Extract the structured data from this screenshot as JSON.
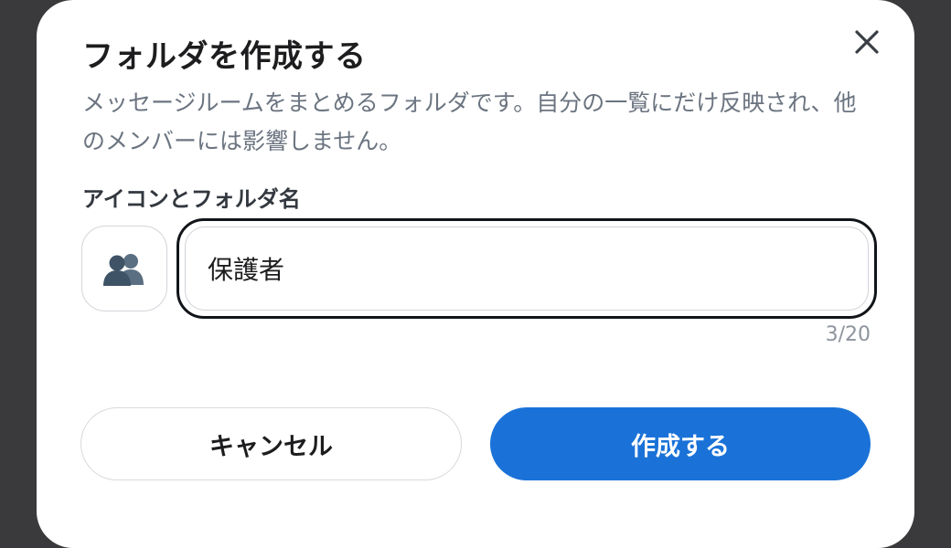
{
  "dialog": {
    "title": "フォルダを作成する",
    "description": "メッセージルームをまとめるフォルダです。自分の一覧にだけ反映され、他のメンバーには影響しません。",
    "close_icon": "close-icon"
  },
  "folder_form": {
    "label": "アイコンとフォルダ名",
    "icon": "busts-in-silhouette-icon",
    "name_value": "保護者",
    "char_counter": "3/20"
  },
  "actions": {
    "cancel_label": "キャンセル",
    "create_label": "作成する"
  },
  "colors": {
    "primary": "#1a72d8",
    "overlay": "#3a3a3c",
    "focus_ring": "#111418",
    "muted_text": "#6b7480"
  }
}
